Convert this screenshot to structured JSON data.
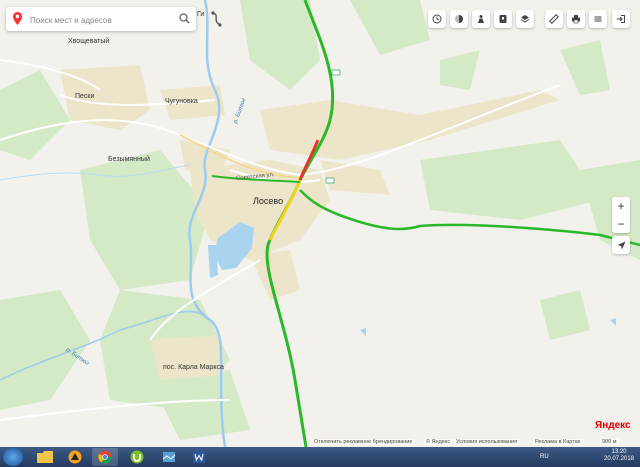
{
  "search": {
    "placeholder": "Поиск мест и адресов"
  },
  "toolbar": {
    "icons": [
      "clock-icon",
      "layers-circle-icon",
      "panorama-icon",
      "bookmark-icon",
      "layers-icon",
      "ruler-icon",
      "print-icon",
      "menu-icon",
      "login-icon"
    ]
  },
  "map": {
    "places": {
      "loseva": "Лосево",
      "khvoshchevaty": "Хвощеватый",
      "peski": "Пески",
      "chugunovka": "Чугуновка",
      "bezymyanny": "Безымянный",
      "karla_marksa": "пос. Карла Маркса",
      "top_cut": "Ги"
    },
    "streets": {
      "sovetskaya": "Советская ул."
    },
    "rivers": {
      "bityug_north": "р. Битюг",
      "bityug_south": "р. Битюг"
    }
  },
  "zoom": {
    "in": "+",
    "out": "−"
  },
  "footer": {
    "ad_off": "Отключить рекламное брендирование",
    "copyright": "© Яндекс",
    "terms": "Условия использования",
    "ads": "Реклама в Картах",
    "scale": "900 м"
  },
  "logo": "Яндекс",
  "taskbar": {
    "apps": [
      "explorer-icon",
      "aimp-icon",
      "chrome-icon",
      "torrent-icon",
      "maps-icon",
      "word-icon"
    ],
    "lang": "RU",
    "time": "13:20",
    "date": "20.07.2018"
  },
  "colors": {
    "traffic_green": "#2ab82a",
    "traffic_yellow": "#f2d21b",
    "traffic_red": "#e2352b",
    "water": "#a9d4f0",
    "settlement": "#ece4c8",
    "forest": "#cfe8c0"
  }
}
